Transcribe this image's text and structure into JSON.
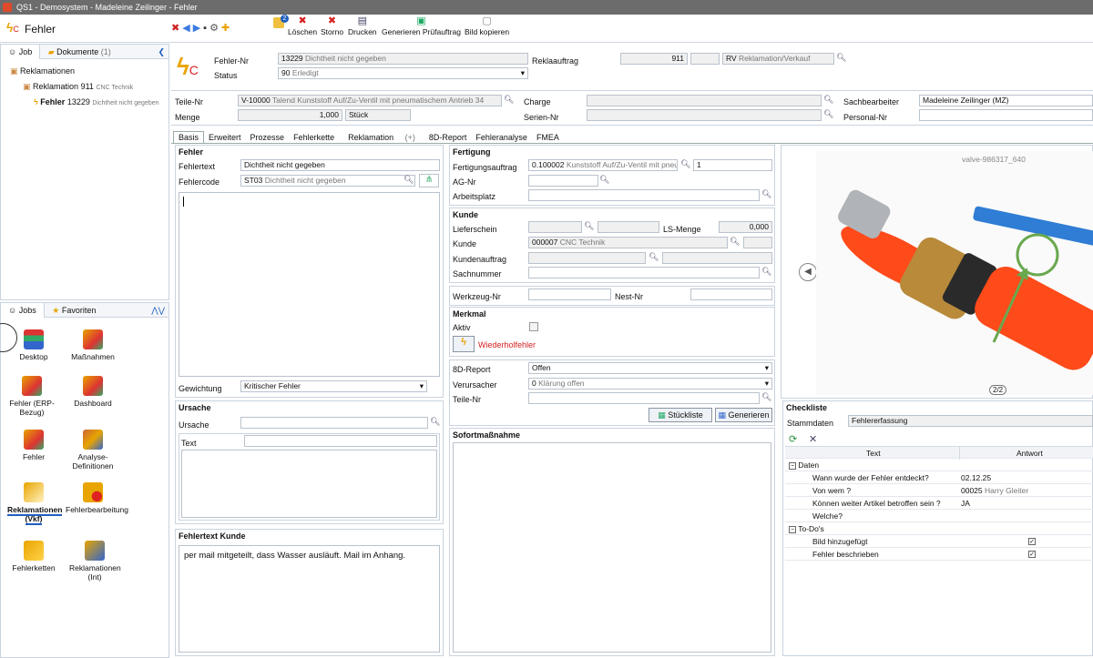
{
  "window": {
    "title": "QS1 - Demosystem - Madeleine Zeilinger - Fehler"
  },
  "app": {
    "title": "Fehler"
  },
  "toolbar": {
    "loeschen": "Löschen",
    "storno": "Storno",
    "drucken": "Drucken",
    "generieren": "Generieren Prüfauftrag",
    "bild_kopieren": "Bild kopieren",
    "badge": "2"
  },
  "left_top": {
    "tab_job": "Job",
    "tab_dokumente": "Dokumente",
    "dokumente_count": "(1)",
    "tree": [
      {
        "label": "Reklamationen"
      },
      {
        "label": "Reklamation",
        "num": "911",
        "sub": "CNC Technik"
      },
      {
        "label": "Fehler",
        "num": "13229",
        "sub": "Dichtheit nicht gegeben"
      }
    ]
  },
  "left_bottom": {
    "tab_jobs": "Jobs",
    "tab_favoriten": "Favoriten",
    "items": [
      "Desktop",
      "Maßnahmen",
      "Fehler (ERP-Bezug)",
      "Dashboard",
      "Fehler",
      "Analyse-Definitionen",
      "Reklamationen (Vkf)",
      "Fehlerbearbeitung",
      "Fehlerketten",
      "Reklamationen (Int)"
    ]
  },
  "header": {
    "fehler_nr_label": "Fehler-Nr",
    "fehler_nr": "13229",
    "fehler_nr_text": "Dichtheit nicht gegeben",
    "status_label": "Status",
    "status_code": "90",
    "status_text": "Erledigt",
    "reklaauftrag_label": "Reklaauftrag",
    "reklaauftrag": "911",
    "rv": "RV",
    "rv_text": "Reklamation/Verkauf"
  },
  "teile": {
    "teile_nr_label": "Teile-Nr",
    "teile_nr": "V-10000",
    "teile_text": "Talend Kunststoff Auf/Zu-Ventil mit pneumatischem Antrieb",
    "teile_extra": "34",
    "menge_label": "Menge",
    "menge": "1,000",
    "einheit": "Stück",
    "charge_label": "Charge",
    "serien_label": "Serien-Nr",
    "sachbearbeiter_label": "Sachbearbeiter",
    "sachbearbeiter": "Madeleine Zeilinger (MZ)",
    "personal_label": "Personal-Nr"
  },
  "tabs": [
    "Basis",
    "Erweitert",
    "Prozesse",
    "Fehlerkette",
    "Reklamation",
    "8D-Report",
    "Fehleranalyse",
    "FMEA"
  ],
  "reklamation_tab_suffix": "(+)",
  "fehler": {
    "title": "Fehler",
    "fehlertext_label": "Fehlertext",
    "fehlertext": "Dichtheit nicht gegeben",
    "fehlercode_label": "Fehlercode",
    "fehlercode": "ST03",
    "fehlercode_text": "Dichtheit nicht gegeben",
    "gewichtung_label": "Gewichtung",
    "gewichtung": "Kritischer Fehler"
  },
  "ursache": {
    "title": "Ursache",
    "ursache_label": "Ursache",
    "text_label": "Text"
  },
  "fehlertext_kunde": {
    "title": "Fehlertext Kunde",
    "text": "per mail mitgeteilt, dass Wasser ausläuft. Mail im Anhang."
  },
  "fertigung": {
    "title": "Fertigung",
    "fa_label": "Fertigungsauftrag",
    "fa": "0.100002",
    "fa_text": "Kunststoff Auf/Zu-Ventil mit pneu",
    "fa_pos": "1",
    "ag_label": "AG-Nr",
    "ap_label": "Arbeitsplatz"
  },
  "kunde": {
    "title": "Kunde",
    "lieferschein_label": "Lieferschein",
    "ls_menge_label": "LS-Menge",
    "ls_menge": "0,000",
    "kunde_label": "Kunde",
    "kunde": "000007",
    "kunde_text": "CNC Technik",
    "kundenauftrag_label": "Kundenauftrag",
    "sachnummer_label": "Sachnummer"
  },
  "werkzeug": {
    "werkzeug_label": "Werkzeug-Nr",
    "nest_label": "Nest-Nr"
  },
  "merkmal": {
    "title": "Merkmal",
    "aktiv_label": "Aktiv",
    "wiederhol": "Wiederholfehler"
  },
  "report": {
    "d8_label": "8D-Report",
    "d8": "Offen",
    "verursacher_label": "Verursacher",
    "verursacher_code": "0",
    "verursacher": "Klärung offen",
    "teile_nr_label": "Teile-Nr",
    "stueckliste": "Stückliste",
    "generieren": "Generieren"
  },
  "sofort": {
    "title": "Sofortmaßnahme"
  },
  "image": {
    "caption": "valve-986317_640",
    "pager": "2/2"
  },
  "checkliste": {
    "title": "Checkliste",
    "stammdaten_label": "Stammdaten",
    "stammdaten": "Fehlererfassung",
    "col_text": "Text",
    "col_antwort": "Antwort",
    "groups": [
      {
        "name": "Daten",
        "rows": [
          {
            "q": "Wann wurde der Fehler entdeckt?",
            "a": "02.12.25"
          },
          {
            "q": "Von wem ?",
            "a": "00025",
            "a2": "Harry Gleiter"
          },
          {
            "q": "Können weiter Artikel betroffen sein ?",
            "a": "JA"
          },
          {
            "q": "Welche?",
            "a": ""
          }
        ]
      },
      {
        "name": "To-Do's",
        "rows": [
          {
            "q": "Bild hinzugefügt",
            "a": "✓"
          },
          {
            "q": "Fehler beschrieben",
            "a": "✓"
          }
        ]
      }
    ]
  },
  "colors": {
    "accent": "#1f5fbf",
    "bolt": "#e8a400",
    "red": "#d62020",
    "hose": "#ff4a1a"
  }
}
